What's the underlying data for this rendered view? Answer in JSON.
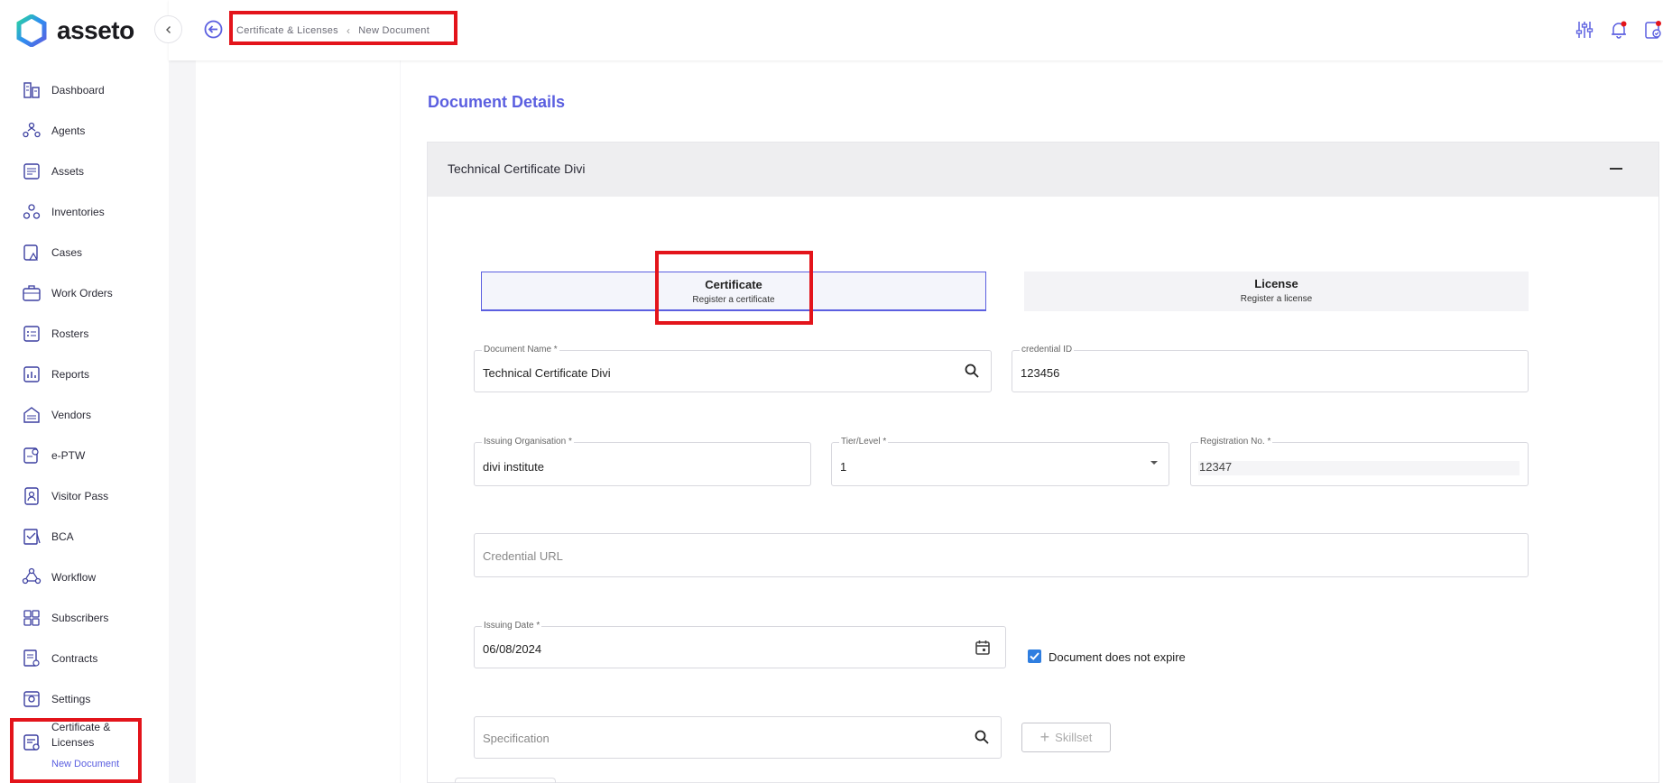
{
  "app": {
    "name": "asseto"
  },
  "colors": {
    "accent": "#5b5fe0",
    "highlight": "#e3141b",
    "checkbox": "#2f7ee0"
  },
  "sidebar": {
    "items": [
      {
        "label": "Dashboard",
        "icon": "dashboard-icon"
      },
      {
        "label": "Agents",
        "icon": "agents-icon"
      },
      {
        "label": "Assets",
        "icon": "assets-icon"
      },
      {
        "label": "Inventories",
        "icon": "inventories-icon"
      },
      {
        "label": "Cases",
        "icon": "cases-icon"
      },
      {
        "label": "Work Orders",
        "icon": "work-orders-icon"
      },
      {
        "label": "Rosters",
        "icon": "rosters-icon"
      },
      {
        "label": "Reports",
        "icon": "reports-icon"
      },
      {
        "label": "Vendors",
        "icon": "vendors-icon"
      },
      {
        "label": "e-PTW",
        "icon": "eptw-icon"
      },
      {
        "label": "Visitor Pass",
        "icon": "visitor-pass-icon"
      },
      {
        "label": "BCA",
        "icon": "bca-icon"
      },
      {
        "label": "Workflow",
        "icon": "workflow-icon"
      },
      {
        "label": "Subscribers",
        "icon": "subscribers-icon"
      },
      {
        "label": "Contracts",
        "icon": "contracts-icon"
      },
      {
        "label": "Settings",
        "icon": "settings-icon"
      }
    ],
    "active": {
      "label": "Certificate & Licenses",
      "sub_label": "New Document",
      "icon": "certificate-icon"
    }
  },
  "header": {
    "breadcrumb": [
      "Certificate & Licenses",
      "New Document"
    ],
    "icons": [
      "filter-sliders-icon",
      "notification-bell-icon",
      "task-check-icon"
    ]
  },
  "main": {
    "section_title": "Document Details",
    "card_title": "Technical Certificate Divi",
    "document_types": [
      {
        "title": "Certificate",
        "subtitle": "Register a certificate",
        "selected": true
      },
      {
        "title": "License",
        "subtitle": "Register a license",
        "selected": false
      }
    ],
    "fields": {
      "document_name": {
        "label": "Document Name *",
        "value": "Technical Certificate Divi"
      },
      "credential_id": {
        "label": "credential ID",
        "value": "123456"
      },
      "issuing_org": {
        "label": "Issuing Organisation *",
        "value": "divi institute"
      },
      "tier_level": {
        "label": "Tier/Level *",
        "value": "1"
      },
      "registration_no": {
        "label": "Registration No. *",
        "value": "12347"
      },
      "credential_url": {
        "placeholder": "Credential URL"
      },
      "issuing_date": {
        "label": "Issuing Date *",
        "value": "06/08/2024"
      },
      "specification": {
        "placeholder": "Specification"
      }
    },
    "no_expiry": {
      "label": "Document does not expire",
      "checked": true
    },
    "skillset_button": {
      "label": "Skillset"
    }
  }
}
